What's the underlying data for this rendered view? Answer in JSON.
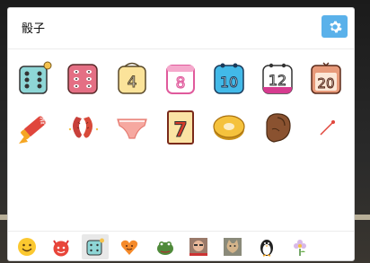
{
  "panel": {
    "title": "骰子"
  },
  "stickers": [
    {
      "icon": "dice-icon"
    },
    {
      "icon": "pink-dice-icon"
    },
    {
      "icon": "calendar-4-icon",
      "text": "4"
    },
    {
      "icon": "calendar-8-icon",
      "text": "8"
    },
    {
      "icon": "calendar-10-icon",
      "text": "10"
    },
    {
      "icon": "calendar-12-icon",
      "text": "12"
    },
    {
      "icon": "calendar-20-icon",
      "text": "20"
    },
    {
      "icon": "firecracker-icon"
    },
    {
      "icon": "sausage-icon"
    },
    {
      "icon": "underwear-icon"
    },
    {
      "icon": "slot-seven-icon",
      "text": "7"
    },
    {
      "icon": "coin-icon"
    },
    {
      "icon": "fist-icon"
    },
    {
      "icon": "pin-icon"
    }
  ],
  "tabs": [
    {
      "icon": "smiley-icon"
    },
    {
      "icon": "devil-icon"
    },
    {
      "icon": "dice-tab-icon",
      "selected": true
    },
    {
      "icon": "heart-face-icon"
    },
    {
      "icon": "frog-icon"
    },
    {
      "icon": "photo-icon"
    },
    {
      "icon": "cat-photo-icon"
    },
    {
      "icon": "penguin-icon"
    },
    {
      "icon": "flower-icon"
    }
  ],
  "colors": {
    "accent": "#5ab1ea"
  }
}
